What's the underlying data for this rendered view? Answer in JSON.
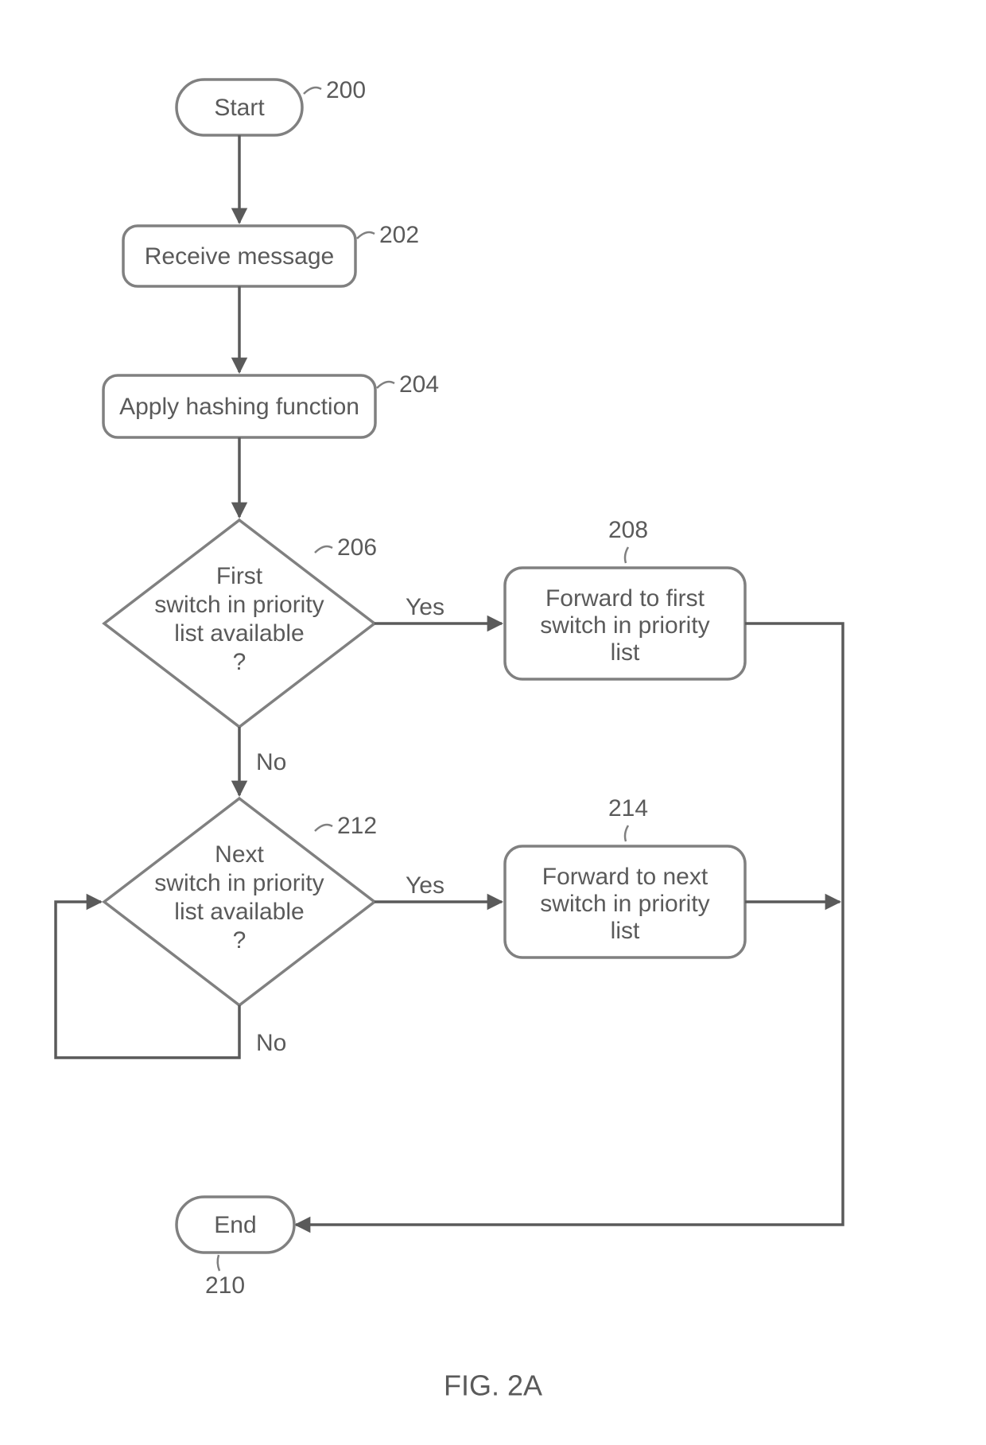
{
  "nodes": {
    "start": {
      "label": "Start",
      "ref": "200"
    },
    "receive": {
      "label": "Receive message",
      "ref": "202"
    },
    "hash": {
      "label": "Apply hashing function",
      "ref": "204"
    },
    "dec1": {
      "l1": "First",
      "l2": "switch in priority",
      "l3": "list available",
      "l4": "?",
      "ref": "206"
    },
    "fwd1": {
      "l1": "Forward to first",
      "l2": "switch in priority",
      "l3": "list",
      "ref": "208"
    },
    "dec2": {
      "l1": "Next",
      "l2": "switch in priority",
      "l3": "list available",
      "l4": "?",
      "ref": "212"
    },
    "fwd2": {
      "l1": "Forward to next",
      "l2": "switch in priority",
      "l3": "list",
      "ref": "214"
    },
    "end": {
      "label": "End",
      "ref": "210"
    }
  },
  "labels": {
    "yes": "Yes",
    "no": "No"
  },
  "figure": "FIG. 2A"
}
